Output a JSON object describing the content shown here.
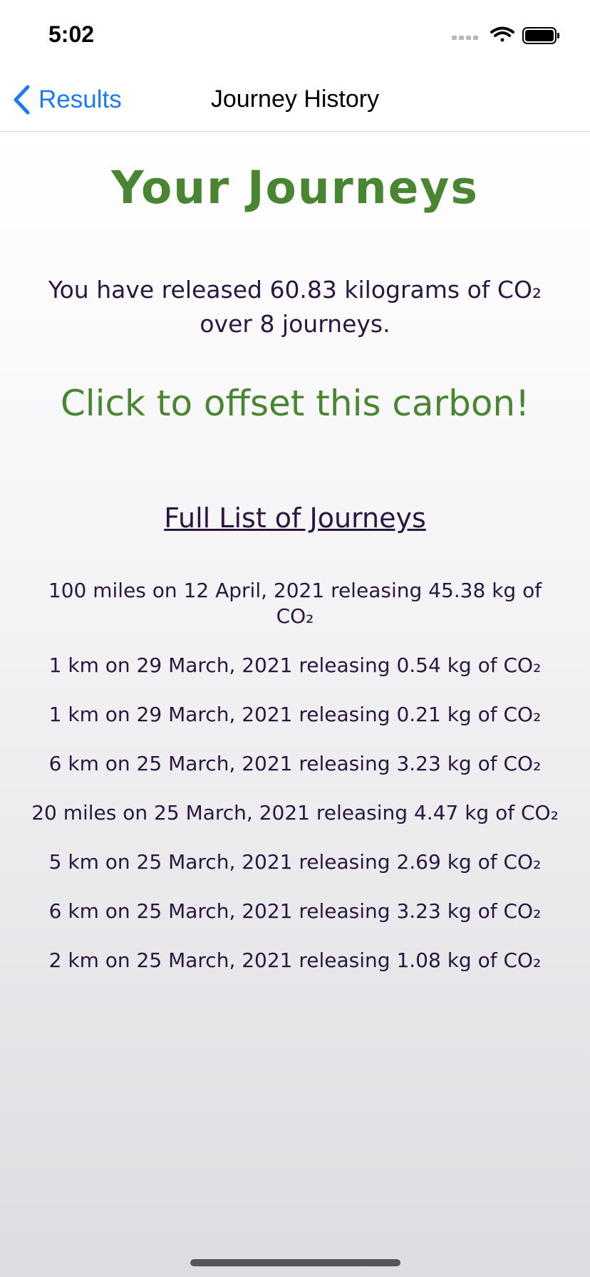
{
  "status_bar": {
    "time": "5:02",
    "icons": [
      "cellular-signal-icon",
      "wifi-icon",
      "battery-icon"
    ]
  },
  "nav": {
    "back_label": "Results",
    "title": "Journey History"
  },
  "main": {
    "title": "Your Journeys",
    "summary_line1": "You have released 60.83 kilograms of CO₂",
    "summary_line2": "over 8 journeys.",
    "offset_cta": "Click to offset this carbon!",
    "list_heading": "Full List of Journeys",
    "journeys": [
      "100 miles on 12 April, 2021 releasing 45.38 kg of CO₂",
      "1 km on 29 March, 2021 releasing 0.54 kg of CO₂",
      "1 km on 29 March, 2021 releasing 0.21 kg of CO₂",
      "6 km on 25 March, 2021 releasing 3.23 kg of CO₂",
      "20 miles on 25 March, 2021 releasing 4.47 kg of CO₂",
      "5 km on 25 March, 2021 releasing 2.69 kg of CO₂",
      "6 km on 25 March, 2021 releasing 3.23 kg of CO₂",
      "2 km on 25 March, 2021 releasing 1.08 kg of CO₂"
    ]
  },
  "colors": {
    "accent_green": "#4a8532",
    "text_purple": "#2a1640",
    "link_blue": "#1a7cf0"
  }
}
